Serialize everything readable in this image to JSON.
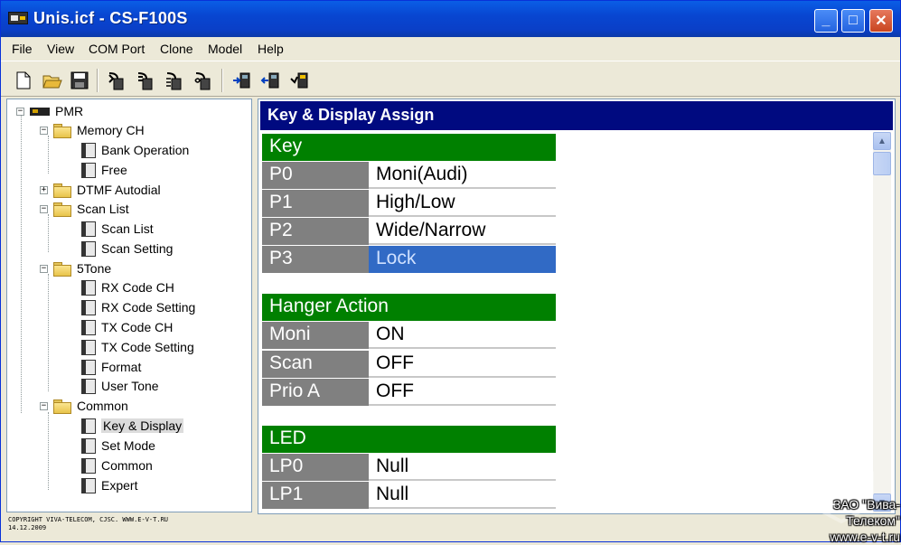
{
  "window": {
    "title": "Unis.icf - CS-F100S",
    "min_label": "_",
    "max_label": "□",
    "close_label": "✕"
  },
  "menu": {
    "items": [
      {
        "label": "File"
      },
      {
        "label": "View"
      },
      {
        "label": "COM Port"
      },
      {
        "label": "Clone"
      },
      {
        "label": "Model"
      },
      {
        "label": "Help"
      }
    ]
  },
  "toolbar": {
    "icons": [
      "new-file-icon",
      "open-folder-icon",
      "save-disk-icon",
      "clone-read-icon",
      "clone-write-icon",
      "clone-compare-icon",
      "clone-step-icon",
      "radio-read-icon",
      "radio-write-icon",
      "radio-info-icon"
    ]
  },
  "tree": {
    "root": "PMR",
    "nodes": [
      {
        "label": "Memory CH"
      },
      {
        "label": "Bank Operation"
      },
      {
        "label": "Free"
      },
      {
        "label": "DTMF Autodial"
      },
      {
        "label": "Scan List"
      },
      {
        "label": "Scan List"
      },
      {
        "label": "Scan Setting"
      },
      {
        "label": "5Tone"
      },
      {
        "label": "RX Code CH"
      },
      {
        "label": "RX Code Setting"
      },
      {
        "label": "TX Code CH"
      },
      {
        "label": "TX Code Setting"
      },
      {
        "label": "Format"
      },
      {
        "label": "User Tone"
      },
      {
        "label": "Common"
      },
      {
        "label": "Key & Display"
      },
      {
        "label": "Set Mode"
      },
      {
        "label": "Common"
      },
      {
        "label": "Expert"
      }
    ]
  },
  "main": {
    "header": "Key & Display Assign",
    "sections": [
      {
        "title": "Key",
        "rows": [
          {
            "key": "P0",
            "value": "Moni(Audi)"
          },
          {
            "key": "P1",
            "value": "High/Low"
          },
          {
            "key": "P2",
            "value": "Wide/Narrow"
          },
          {
            "key": "P3",
            "value": "Lock"
          }
        ]
      },
      {
        "title": "Hanger Action",
        "rows": [
          {
            "key": "Moni",
            "value": "ON"
          },
          {
            "key": "Scan",
            "value": "OFF"
          },
          {
            "key": "Prio A",
            "value": "OFF"
          }
        ]
      },
      {
        "title": "LED",
        "rows": [
          {
            "key": "LP0",
            "value": "Null"
          },
          {
            "key": "LP1",
            "value": "Null"
          }
        ]
      }
    ]
  },
  "status": {
    "copyright_line1": "COPYRIGHT VIVA-TELECOM, CJSC. WWW.E-V-T.RU",
    "copyright_line2": "14.12.2009"
  },
  "watermark": {
    "company": "ЗАО \"Вива-Телеком\"",
    "url": "www.e-v-t.ru"
  },
  "colors": {
    "titlebar": "#0a4fd6",
    "panel_header": "#000a80",
    "section_header": "#008000",
    "row_key": "#808080",
    "selected": "#316ac5"
  }
}
